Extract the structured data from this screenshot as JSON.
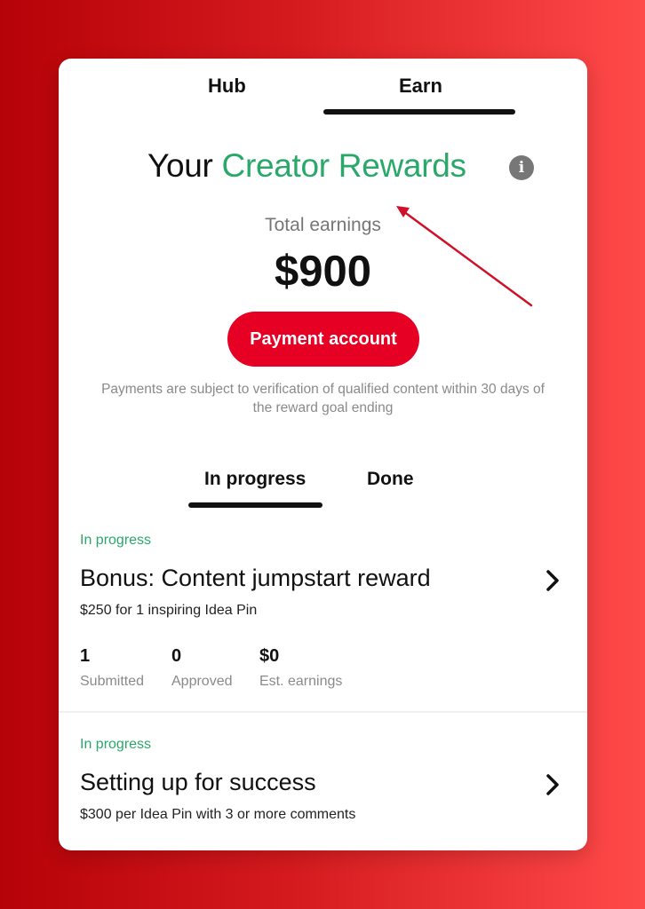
{
  "tabs": {
    "hub": "Hub",
    "earn": "Earn"
  },
  "header": {
    "title_prefix": "Your",
    "title_accent": "Creator Rewards",
    "info_icon": "info-icon",
    "info_glyph": "i"
  },
  "earnings": {
    "label": "Total earnings",
    "amount": "$900"
  },
  "payment_button_label": "Payment account",
  "disclaimer": "Payments are subject to verification of qualified content within 30 days of the reward goal ending",
  "sub_tabs": {
    "in_progress": "In progress",
    "done": "Done"
  },
  "rewards": [
    {
      "status": "In progress",
      "title": "Bonus: Content jumpstart reward",
      "description": "$250 for 1 inspiring Idea Pin",
      "stats": [
        {
          "value": "1",
          "label": "Submitted"
        },
        {
          "value": "0",
          "label": "Approved"
        },
        {
          "value": "$0",
          "label": "Est. earnings"
        }
      ]
    },
    {
      "status": "In progress",
      "title": "Setting up for success",
      "description": "$300 per Idea Pin with 3 or more comments"
    }
  ],
  "colors": {
    "accent_green": "#2aa86a",
    "brand_red": "#e60023",
    "annotation_arrow": "#d0102a"
  }
}
